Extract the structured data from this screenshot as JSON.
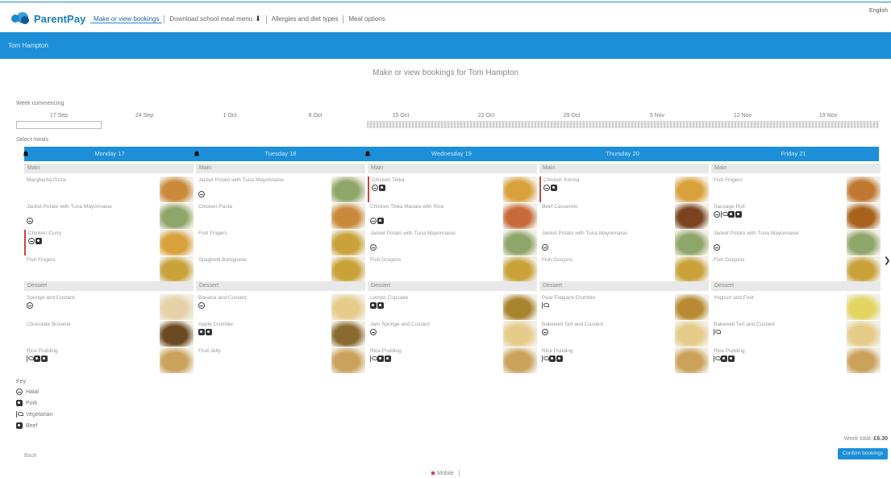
{
  "nav": {
    "brand": "ParentPay",
    "links": [
      "Make or view bookings",
      "Download school meal menu",
      "Allergies and diet types",
      "Meal options"
    ],
    "language": "English"
  },
  "student": {
    "name": "Tom Hampton"
  },
  "page": {
    "heading": "Make or view bookings for Tom Hampton",
    "week_label": "Week commencing",
    "select_label": "Select meals"
  },
  "weeks": [
    "17 Sep",
    "24 Sep",
    "1 Oct",
    "8 Oct",
    "15 Oct",
    "22 Oct",
    "29 Oct",
    "5 Nov",
    "12 Nov",
    "19 Nov"
  ],
  "days": [
    "Monday 17",
    "Tuesday 18",
    "Wednesday 19",
    "Thursday 20",
    "Friday 21"
  ],
  "day_alerts": [
    true,
    true,
    true,
    false,
    false
  ],
  "sections": {
    "main": "Main",
    "dessert": "Dessert"
  },
  "menu": [
    {
      "main": [
        {
          "name": "Margherita Pizza",
          "icons": [],
          "thumb": "#c98a3c",
          "selected": false
        },
        {
          "name": "Jacket Potato with Tuna Mayonnaise",
          "icons": [
            "halal"
          ],
          "thumb": "#8fa66a",
          "selected": false
        },
        {
          "name": "Chicken Curry",
          "icons": [
            "halal",
            "pork"
          ],
          "thumb": "#d9a13b",
          "selected": true
        },
        {
          "name": "Fish Fingers",
          "icons": [],
          "thumb": "#c9a23a",
          "selected": false
        }
      ],
      "dessert": [
        {
          "name": "Sponge and Custard",
          "icons": [
            "halal"
          ],
          "thumb": "#e6d2a8",
          "selected": false
        },
        {
          "name": "Chocolate Brownie",
          "icons": [],
          "thumb": "#6b4a22",
          "selected": false
        },
        {
          "name": "Rice Pudding",
          "icons": [
            "veg",
            "pork",
            "pork"
          ],
          "thumb": "#caa25c",
          "selected": false
        }
      ]
    },
    {
      "main": [
        {
          "name": "Jacket Potato with Tuna Mayonnaise",
          "icons": [
            "halal"
          ],
          "thumb": "#8fa66a",
          "selected": false
        },
        {
          "name": "Chicken Pasta",
          "icons": [],
          "thumb": "#c98a3c",
          "selected": false
        },
        {
          "name": "Fish Fingers",
          "icons": [],
          "thumb": "#c9a23a",
          "selected": false
        },
        {
          "name": "Spaghetti Bolognese",
          "icons": [],
          "thumb": "#c9a23a",
          "selected": false
        }
      ],
      "dessert": [
        {
          "name": "Banana and Custard",
          "icons": [
            "halal"
          ],
          "thumb": "#e6cc8a",
          "selected": false
        },
        {
          "name": "Apple Crumble",
          "icons": [
            "pork",
            "pork"
          ],
          "thumb": "#8a6a30",
          "selected": false
        },
        {
          "name": "Fruit Jelly",
          "icons": [],
          "thumb": "#caa25c",
          "selected": false
        }
      ]
    },
    {
      "main": [
        {
          "name": "Chicken Tikka",
          "icons": [
            "halal",
            "pork"
          ],
          "thumb": "#d9a13b",
          "selected": true
        },
        {
          "name": "Chicken Tikka Masala with Rice",
          "icons": [
            "halal",
            "pork"
          ],
          "thumb": "#c76a3a",
          "selected": false
        },
        {
          "name": "Jacket Potato with Tuna Mayonnaise",
          "icons": [
            "halal"
          ],
          "thumb": "#8fa66a",
          "selected": false
        },
        {
          "name": "Fish Goujons",
          "icons": [],
          "thumb": "#c9a23a",
          "selected": false
        }
      ],
      "dessert": [
        {
          "name": "Lemon Cupcake",
          "icons": [
            "pork",
            "pork"
          ],
          "thumb": "#a8842e",
          "selected": false
        },
        {
          "name": "Jam Sponge and Custard",
          "icons": [
            "halal"
          ],
          "thumb": "#e6cc8a",
          "selected": false
        },
        {
          "name": "Rice Pudding",
          "icons": [
            "veg",
            "pork",
            "pork"
          ],
          "thumb": "#caa25c",
          "selected": false
        }
      ]
    },
    {
      "main": [
        {
          "name": "Chicken Korma",
          "icons": [
            "halal",
            "pork"
          ],
          "thumb": "#d9a13b",
          "selected": true
        },
        {
          "name": "Beef Casserole",
          "icons": [],
          "thumb": "#7a4420",
          "selected": false
        },
        {
          "name": "Jacket Potato with Tuna Mayonnaise",
          "icons": [
            "halal"
          ],
          "thumb": "#8fa66a",
          "selected": false
        },
        {
          "name": "Fish Goujons",
          "icons": [],
          "thumb": "#c9a23a",
          "selected": false
        }
      ],
      "dessert": [
        {
          "name": "Pear Flapjack Crumble",
          "icons": [
            "veg"
          ],
          "thumb": "#b88a32",
          "selected": false
        },
        {
          "name": "Bakewell Tart and Custard",
          "icons": [
            "halal"
          ],
          "thumb": "#e6cc8a",
          "selected": false
        },
        {
          "name": "Rice Pudding",
          "icons": [
            "veg",
            "pork",
            "pork"
          ],
          "thumb": "#caa25c",
          "selected": false
        }
      ]
    },
    {
      "main": [
        {
          "name": "Fish Fingers",
          "icons": [],
          "thumb": "#c07830",
          "selected": false
        },
        {
          "name": "Sausage Roll",
          "icons": [
            "halal",
            "veg",
            "pork",
            "pork"
          ],
          "thumb": "#a8621e",
          "selected": false
        },
        {
          "name": "Jacket Potato with Tuna Mayonnaise",
          "icons": [
            "halal"
          ],
          "thumb": "#8fa66a",
          "selected": false
        },
        {
          "name": "Fish Goujons",
          "icons": [],
          "thumb": "#c9a23a",
          "selected": false
        }
      ],
      "dessert": [
        {
          "name": "Yoghurt and Fruit",
          "icons": [],
          "thumb": "#e2d560",
          "selected": false
        },
        {
          "name": "Bakewell Tart and Custard",
          "icons": [
            "veg"
          ],
          "thumb": "#e6cc8a",
          "selected": false
        },
        {
          "name": "Rice Pudding",
          "icons": [
            "veg",
            "pork",
            "pork"
          ],
          "thumb": "#caa25c",
          "selected": false
        }
      ]
    }
  ],
  "legend": {
    "title": "Key",
    "items": [
      {
        "icon": "halal",
        "label": "Halal"
      },
      {
        "icon": "pork",
        "label": "Pork"
      },
      {
        "icon": "veg",
        "label": "Vegetarian"
      },
      {
        "icon": "pork",
        "label": "Beef"
      }
    ]
  },
  "footer": {
    "back_label": "Back",
    "total_label": "Week total:",
    "total_value": "£6.30",
    "confirm_label": "Confirm bookings",
    "bottom_link": "Mobile"
  },
  "colors": {
    "accent": "#1d8fd8",
    "selected_marker": "#c8453c"
  }
}
